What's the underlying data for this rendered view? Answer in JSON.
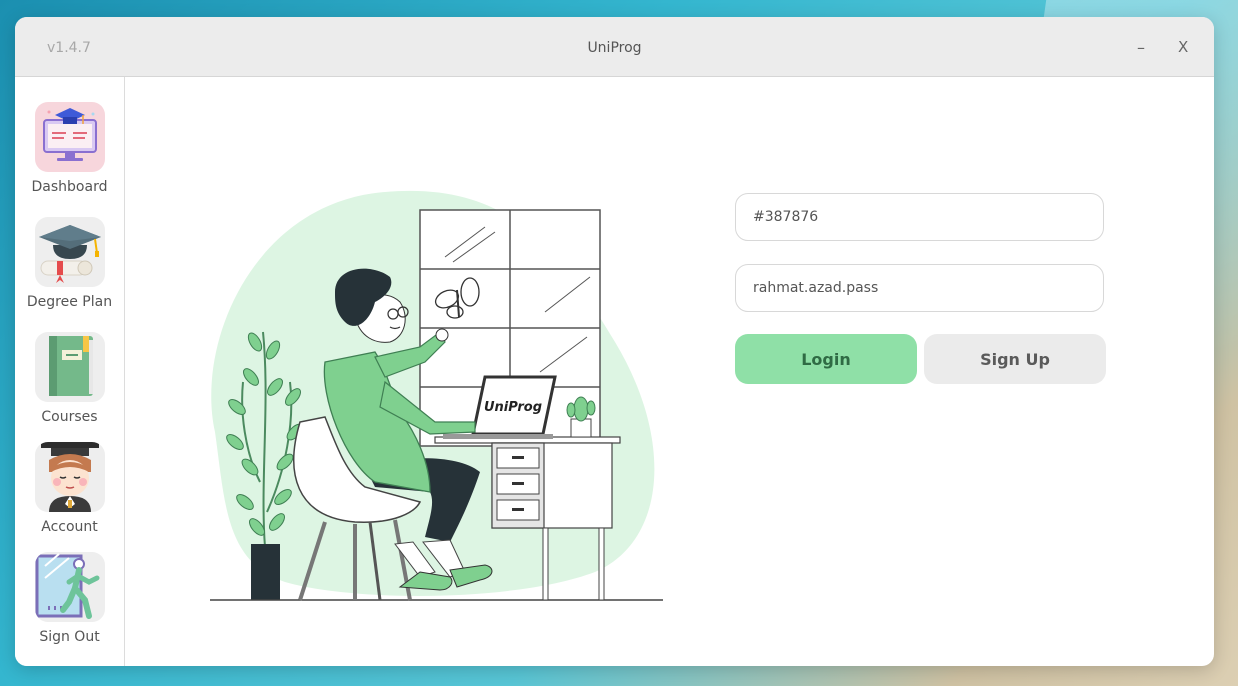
{
  "window": {
    "version": "v1.4.7",
    "title": "UniProg",
    "minimize_label": "–",
    "close_label": "X"
  },
  "sidebar": {
    "items": [
      {
        "label": "Dashboard",
        "icon": "dashboard-icon"
      },
      {
        "label": "Degree Plan",
        "icon": "graduation-cap-icon"
      },
      {
        "label": "Courses",
        "icon": "notebook-icon"
      },
      {
        "label": "Account",
        "icon": "student-avatar-icon"
      },
      {
        "label": "Sign Out",
        "icon": "exit-door-icon"
      }
    ]
  },
  "illustration": {
    "laptop_text": "UniProg"
  },
  "login_form": {
    "id_value": "#387876",
    "password_value": "rahmat.azad.pass",
    "login_label": "Login",
    "signup_label": "Sign Up"
  },
  "colors": {
    "accent_green": "#8fe0a7",
    "blob_green": "#ddf5e3",
    "titlebar": "#ececec"
  }
}
